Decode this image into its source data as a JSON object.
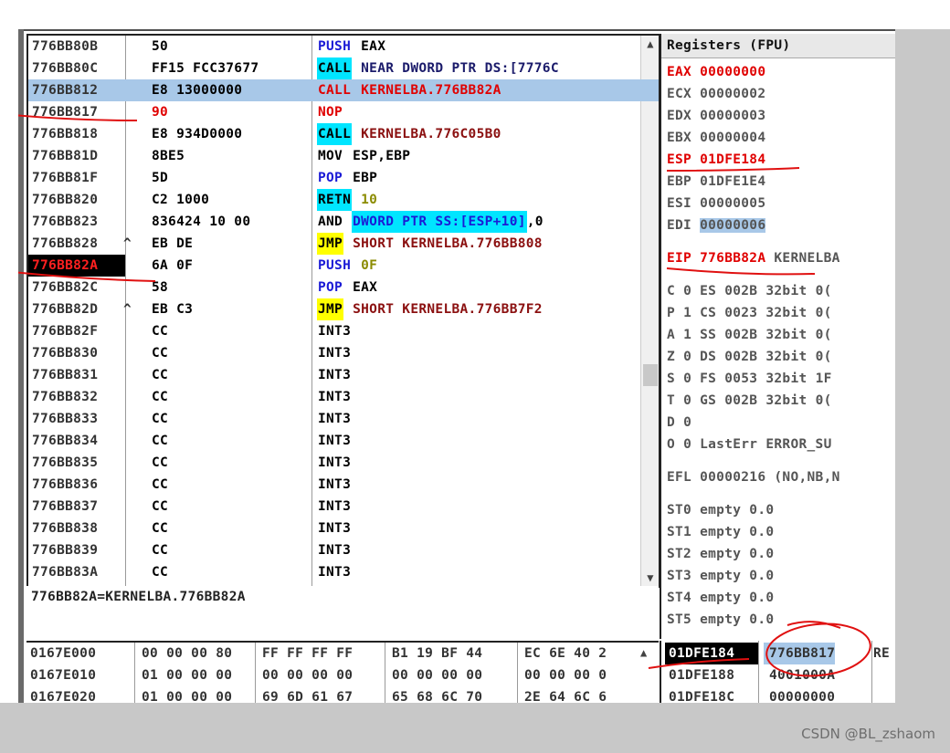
{
  "disassembly": {
    "rows": [
      {
        "addr": "776BB80B",
        "mark": "",
        "hex": "50",
        "mnemonic": "PUSH",
        "mnemonic_style": "push",
        "operand": "EAX",
        "operand_style": "plain"
      },
      {
        "addr": "776BB80C",
        "mark": "",
        "hex": "FF15 FCC37677",
        "mnemonic": "CALL",
        "mnemonic_style": "call",
        "operand": "NEAR DWORD PTR DS:[7776C",
        "operand_style": "navy"
      },
      {
        "addr": "776BB812",
        "mark": "",
        "hex": "E8 13000000",
        "mnemonic": "CALL",
        "mnemonic_style": "red",
        "operand": "KERNELBA.776BB82A",
        "operand_style": "red",
        "selected": true
      },
      {
        "addr": "776BB817",
        "mark": "",
        "hex": "90",
        "mnemonic": "NOP",
        "mnemonic_style": "red",
        "operand": "",
        "operand_style": "plain",
        "hex_red": true
      },
      {
        "addr": "776BB818",
        "mark": "",
        "hex": "E8 934D0000",
        "mnemonic": "CALL",
        "mnemonic_style": "call",
        "operand": "KERNELBA.776C05B0",
        "operand_style": "maroon"
      },
      {
        "addr": "776BB81D",
        "mark": "",
        "hex": "8BE5",
        "mnemonic": "MOV",
        "mnemonic_style": "plain",
        "operand": "ESP,EBP",
        "operand_style": "plain"
      },
      {
        "addr": "776BB81F",
        "mark": "",
        "hex": "5D",
        "mnemonic": "POP",
        "mnemonic_style": "push",
        "operand": "EBP",
        "operand_style": "plain"
      },
      {
        "addr": "776BB820",
        "mark": "",
        "hex": "C2 1000",
        "mnemonic": "RETN",
        "mnemonic_style": "call",
        "operand": "10",
        "operand_style": "olive"
      },
      {
        "addr": "776BB823",
        "mark": "",
        "hex": "836424 10 00",
        "mnemonic": "AND",
        "mnemonic_style": "plain",
        "operand": "DWORD PTR SS:[ESP+10]",
        "operand_style": "cyanbg",
        "operand_suffix": ",0"
      },
      {
        "addr": "776BB828",
        "mark": "^",
        "hex": "EB DE",
        "mnemonic": "JMP",
        "mnemonic_style": "jmp",
        "operand": "SHORT KERNELBA.776BB808",
        "operand_style": "maroon"
      },
      {
        "addr": "776BB82A",
        "mark": "",
        "hex": "6A 0F",
        "mnemonic": "PUSH",
        "mnemonic_style": "push",
        "operand": "0F",
        "operand_style": "olive",
        "addr_hl": true
      },
      {
        "addr": "776BB82C",
        "mark": "",
        "hex": "58",
        "mnemonic": "POP",
        "mnemonic_style": "push",
        "operand": "EAX",
        "operand_style": "plain"
      },
      {
        "addr": "776BB82D",
        "mark": "^",
        "hex": "EB C3",
        "mnemonic": "JMP",
        "mnemonic_style": "jmp",
        "operand": "SHORT KERNELBA.776BB7F2",
        "operand_style": "maroon"
      },
      {
        "addr": "776BB82F",
        "mark": "",
        "hex": "CC",
        "mnemonic": "INT3",
        "mnemonic_style": "plain",
        "operand": "",
        "operand_style": "plain"
      },
      {
        "addr": "776BB830",
        "mark": "",
        "hex": "CC",
        "mnemonic": "INT3",
        "mnemonic_style": "plain",
        "operand": "",
        "operand_style": "plain"
      },
      {
        "addr": "776BB831",
        "mark": "",
        "hex": "CC",
        "mnemonic": "INT3",
        "mnemonic_style": "plain",
        "operand": "",
        "operand_style": "plain"
      },
      {
        "addr": "776BB832",
        "mark": "",
        "hex": "CC",
        "mnemonic": "INT3",
        "mnemonic_style": "plain",
        "operand": "",
        "operand_style": "plain"
      },
      {
        "addr": "776BB833",
        "mark": "",
        "hex": "CC",
        "mnemonic": "INT3",
        "mnemonic_style": "plain",
        "operand": "",
        "operand_style": "plain"
      },
      {
        "addr": "776BB834",
        "mark": "",
        "hex": "CC",
        "mnemonic": "INT3",
        "mnemonic_style": "plain",
        "operand": "",
        "operand_style": "plain"
      },
      {
        "addr": "776BB835",
        "mark": "",
        "hex": "CC",
        "mnemonic": "INT3",
        "mnemonic_style": "plain",
        "operand": "",
        "operand_style": "plain"
      },
      {
        "addr": "776BB836",
        "mark": "",
        "hex": "CC",
        "mnemonic": "INT3",
        "mnemonic_style": "plain",
        "operand": "",
        "operand_style": "plain"
      },
      {
        "addr": "776BB837",
        "mark": "",
        "hex": "CC",
        "mnemonic": "INT3",
        "mnemonic_style": "plain",
        "operand": "",
        "operand_style": "plain"
      },
      {
        "addr": "776BB838",
        "mark": "",
        "hex": "CC",
        "mnemonic": "INT3",
        "mnemonic_style": "plain",
        "operand": "",
        "operand_style": "plain"
      },
      {
        "addr": "776BB839",
        "mark": "",
        "hex": "CC",
        "mnemonic": "INT3",
        "mnemonic_style": "plain",
        "operand": "",
        "operand_style": "plain"
      },
      {
        "addr": "776BB83A",
        "mark": "",
        "hex": "CC",
        "mnemonic": "INT3",
        "mnemonic_style": "plain",
        "operand": "",
        "operand_style": "plain"
      }
    ]
  },
  "info_line": "776BB82A=KERNELBA.776BB82A",
  "dump": {
    "rows": [
      {
        "addr": "0167E000",
        "g1": "00 00 00 80",
        "g2": "FF FF FF FF",
        "g3": "B1 19 BF 44",
        "g4": "EC 6E 40 2"
      },
      {
        "addr": "0167E010",
        "g1": "01 00 00 00",
        "g2": "00 00 00 00",
        "g3": "00 00 00 00",
        "g4": "00 00 00 0"
      },
      {
        "addr": "0167E020",
        "g1": "01 00 00 00",
        "g2": "69 6D 61 67",
        "g3": "65 68 6C 70",
        "g4": "2E 64 6C 6"
      }
    ]
  },
  "registers": {
    "title": "Registers (FPU)",
    "gp": [
      {
        "name": "EAX",
        "value": "00000000",
        "changed": true
      },
      {
        "name": "ECX",
        "value": "00000002",
        "changed": false
      },
      {
        "name": "EDX",
        "value": "00000003",
        "changed": false
      },
      {
        "name": "EBX",
        "value": "00000004",
        "changed": false
      },
      {
        "name": "ESP",
        "value": "01DFE184",
        "changed": true
      },
      {
        "name": "EBP",
        "value": "01DFE1E4",
        "changed": false
      },
      {
        "name": "ESI",
        "value": "00000005",
        "changed": false
      },
      {
        "name": "EDI",
        "value": "00000006",
        "changed": false,
        "highlight": true
      }
    ],
    "eip": {
      "name": "EIP",
      "value": "776BB82A",
      "comment": "KERNELBA"
    },
    "flags": [
      {
        "flag": "C",
        "bit": "0",
        "seg": "ES",
        "sel": "002B",
        "bits": "32bit",
        "base": "0("
      },
      {
        "flag": "P",
        "bit": "1",
        "seg": "CS",
        "sel": "0023",
        "bits": "32bit",
        "base": "0("
      },
      {
        "flag": "A",
        "bit": "1",
        "seg": "SS",
        "sel": "002B",
        "bits": "32bit",
        "base": "0("
      },
      {
        "flag": "Z",
        "bit": "0",
        "seg": "DS",
        "sel": "002B",
        "bits": "32bit",
        "base": "0("
      },
      {
        "flag": "S",
        "bit": "0",
        "seg": "FS",
        "sel": "0053",
        "bits": "32bit",
        "base": "1F"
      },
      {
        "flag": "T",
        "bit": "0",
        "seg": "GS",
        "sel": "002B",
        "bits": "32bit",
        "base": "0("
      },
      {
        "flag": "D",
        "bit": "0",
        "seg": "",
        "sel": "",
        "bits": "",
        "base": ""
      }
    ],
    "lasterr": {
      "flag": "O",
      "bit": "0",
      "text": "LastErr ERROR_SU"
    },
    "efl": {
      "name": "EFL",
      "value": "00000216",
      "text": "(NO,NB,N"
    },
    "fpu": [
      {
        "name": "ST0",
        "text": "empty 0.0"
      },
      {
        "name": "ST1",
        "text": "empty 0.0"
      },
      {
        "name": "ST2",
        "text": "empty 0.0"
      },
      {
        "name": "ST3",
        "text": "empty 0.0"
      },
      {
        "name": "ST4",
        "text": "empty 0.0"
      },
      {
        "name": "ST5",
        "text": "empty 0.0"
      }
    ]
  },
  "stack": {
    "rows": [
      {
        "addr": "01DFE184",
        "value": "776BB817",
        "comment": "RE",
        "current": true
      },
      {
        "addr": "01DFE188",
        "value": "4001000A",
        "comment": "",
        "current": false
      },
      {
        "addr": "01DFE18C",
        "value": "00000000",
        "comment": "",
        "current": false
      }
    ]
  },
  "colors": {
    "selection": "#a8c8e8",
    "annotation_red": "#e01010",
    "call_bg": "#00e5ff",
    "jmp_bg": "#ffff00"
  },
  "watermark": "CSDN @BL_zshaom"
}
